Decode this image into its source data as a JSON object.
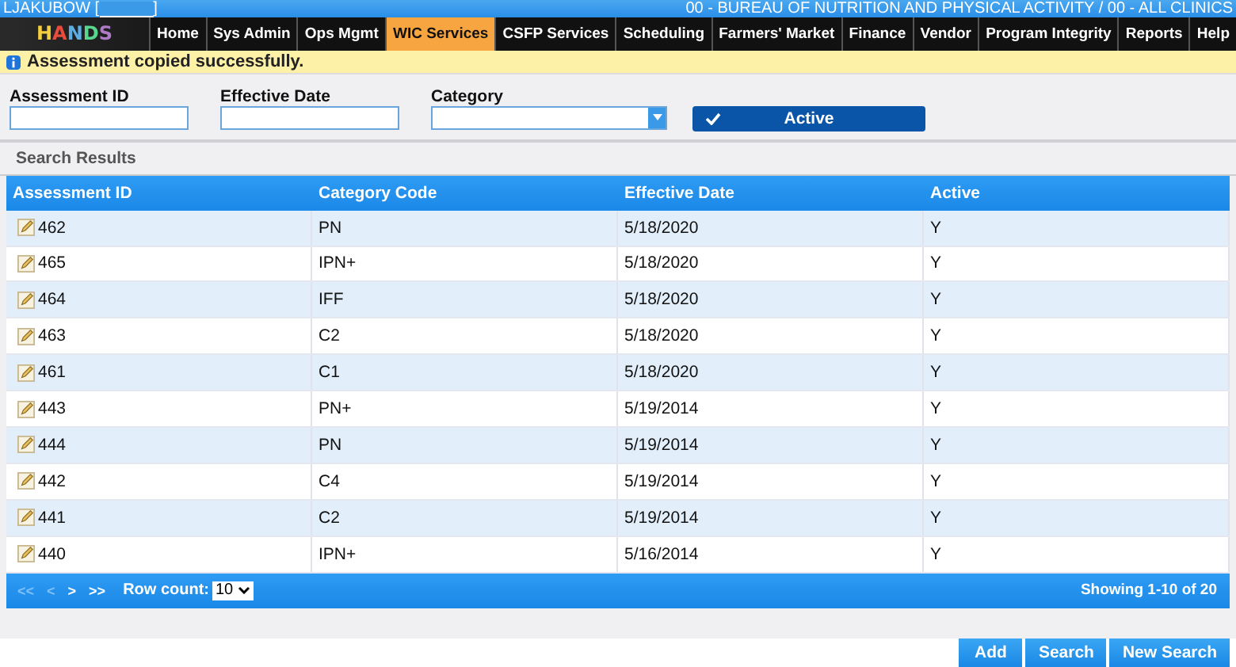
{
  "header": {
    "user": "LJAKUBOW [",
    "user_close": "]",
    "agency": "00 - BUREAU OF NUTRITION AND PHYSICAL ACTIVITY / 00 - ALL CLINICS"
  },
  "logo": "HANDS",
  "nav": [
    {
      "label": "Home",
      "selected": false
    },
    {
      "label": "Sys Admin",
      "selected": false
    },
    {
      "label": "Ops Mgmt",
      "selected": false
    },
    {
      "label": "WIC Services",
      "selected": true
    },
    {
      "label": "CSFP Services",
      "selected": false
    },
    {
      "label": "Scheduling",
      "selected": false
    },
    {
      "label": "Farmers' Market",
      "selected": false
    },
    {
      "label": "Finance",
      "selected": false
    },
    {
      "label": "Vendor",
      "selected": false
    },
    {
      "label": "Program Integrity",
      "selected": false
    },
    {
      "label": "Reports",
      "selected": false
    },
    {
      "label": "Help",
      "selected": false
    }
  ],
  "message": {
    "kind": "info",
    "text": "Assessment copied successfully."
  },
  "filters": [
    {
      "kind": "text",
      "label": "Assessment ID"
    },
    {
      "kind": "text",
      "label": "Effective Date"
    },
    {
      "kind": "select",
      "label": "Category"
    }
  ],
  "active_toggle": {
    "label": "Active",
    "on": true
  },
  "results": {
    "title": "Search Results",
    "columns": [
      "Assessment ID",
      "Category Code",
      "Effective Date",
      "Active"
    ],
    "rows": [
      [
        "462",
        "PN",
        "5/18/2020",
        "Y"
      ],
      [
        "465",
        "IPN+",
        "5/18/2020",
        "Y"
      ],
      [
        "464",
        "IFF",
        "5/18/2020",
        "Y"
      ],
      [
        "463",
        "C2",
        "5/18/2020",
        "Y"
      ],
      [
        "461",
        "C1",
        "5/18/2020",
        "Y"
      ],
      [
        "443",
        "PN+",
        "5/19/2014",
        "Y"
      ],
      [
        "444",
        "PN",
        "5/19/2014",
        "Y"
      ],
      [
        "442",
        "C4",
        "5/19/2014",
        "Y"
      ],
      [
        "441",
        "C2",
        "5/19/2014",
        "Y"
      ],
      [
        "440",
        "IPN+",
        "5/16/2014",
        "Y"
      ]
    ]
  },
  "pager": {
    "buttons": [
      {
        "label": "<<",
        "disabled": true
      },
      {
        "label": "<",
        "disabled": true
      },
      {
        "label": ">",
        "disabled": false
      },
      {
        "label": ">>",
        "disabled": false
      }
    ],
    "row_count_label": "Row count:",
    "row_count": "10",
    "summary": "Showing 1-10 of 20"
  },
  "buttons": [
    "Add",
    "Search",
    "New Search"
  ]
}
